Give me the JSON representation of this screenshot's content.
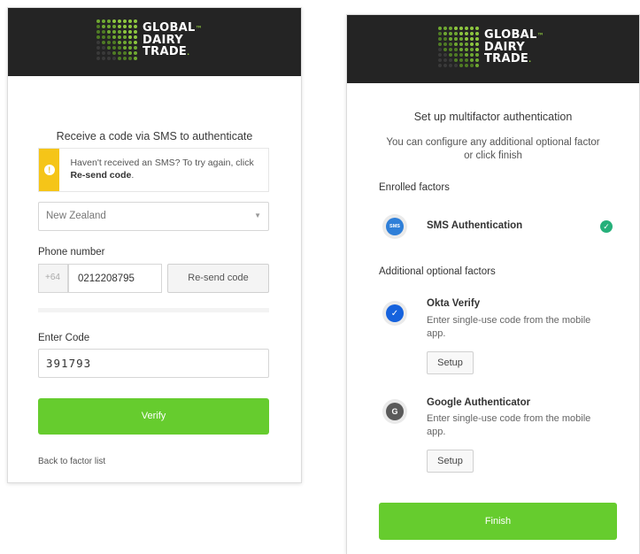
{
  "brand": {
    "line1": "GLOBAL",
    "line2": "DAIRY",
    "line3": "TRADE",
    "trademark": "™",
    "dot_colors": [
      "#8dc63f",
      "#6fa832",
      "#4f7c24",
      "#3a3a3a"
    ]
  },
  "sms_form": {
    "title": "Receive a code via SMS to authenticate",
    "warning": {
      "icon": "warning-icon",
      "text": "Haven't received an SMS? To try again, click ",
      "bold_text": "Re-send code",
      "suffix": "."
    },
    "country": {
      "selected": "New Zealand"
    },
    "phone_label": "Phone number",
    "country_code": "+64",
    "phone_value": "0212208795",
    "resend_label": "Re-send code",
    "code_label": "Enter Code",
    "code_value": "391793",
    "verify_label": "Verify",
    "back_link": "Back to factor list"
  },
  "mfa_setup": {
    "title": "Set up multifactor authentication",
    "subtitle": "You can configure any additional optional factor or click finish",
    "enrolled_label": "Enrolled factors",
    "enrolled": [
      {
        "name": "SMS Authentication",
        "icon": "sms-icon",
        "icon_text": "SMS",
        "status": "enrolled"
      }
    ],
    "optional_label": "Additional optional factors",
    "optional": [
      {
        "name": "Okta Verify",
        "description": "Enter single-use code from the mobile app.",
        "icon": "okta-verify-icon",
        "button": "Setup"
      },
      {
        "name": "Google Authenticator",
        "description": "Enter single-use code from the mobile app.",
        "icon": "google-authenticator-icon",
        "button": "Setup"
      }
    ],
    "finish_label": "Finish"
  },
  "colors": {
    "header_bg": "#242424",
    "accent_green": "#66cc2e",
    "warning_yellow": "#f5c518",
    "check_green": "#26b07a"
  }
}
